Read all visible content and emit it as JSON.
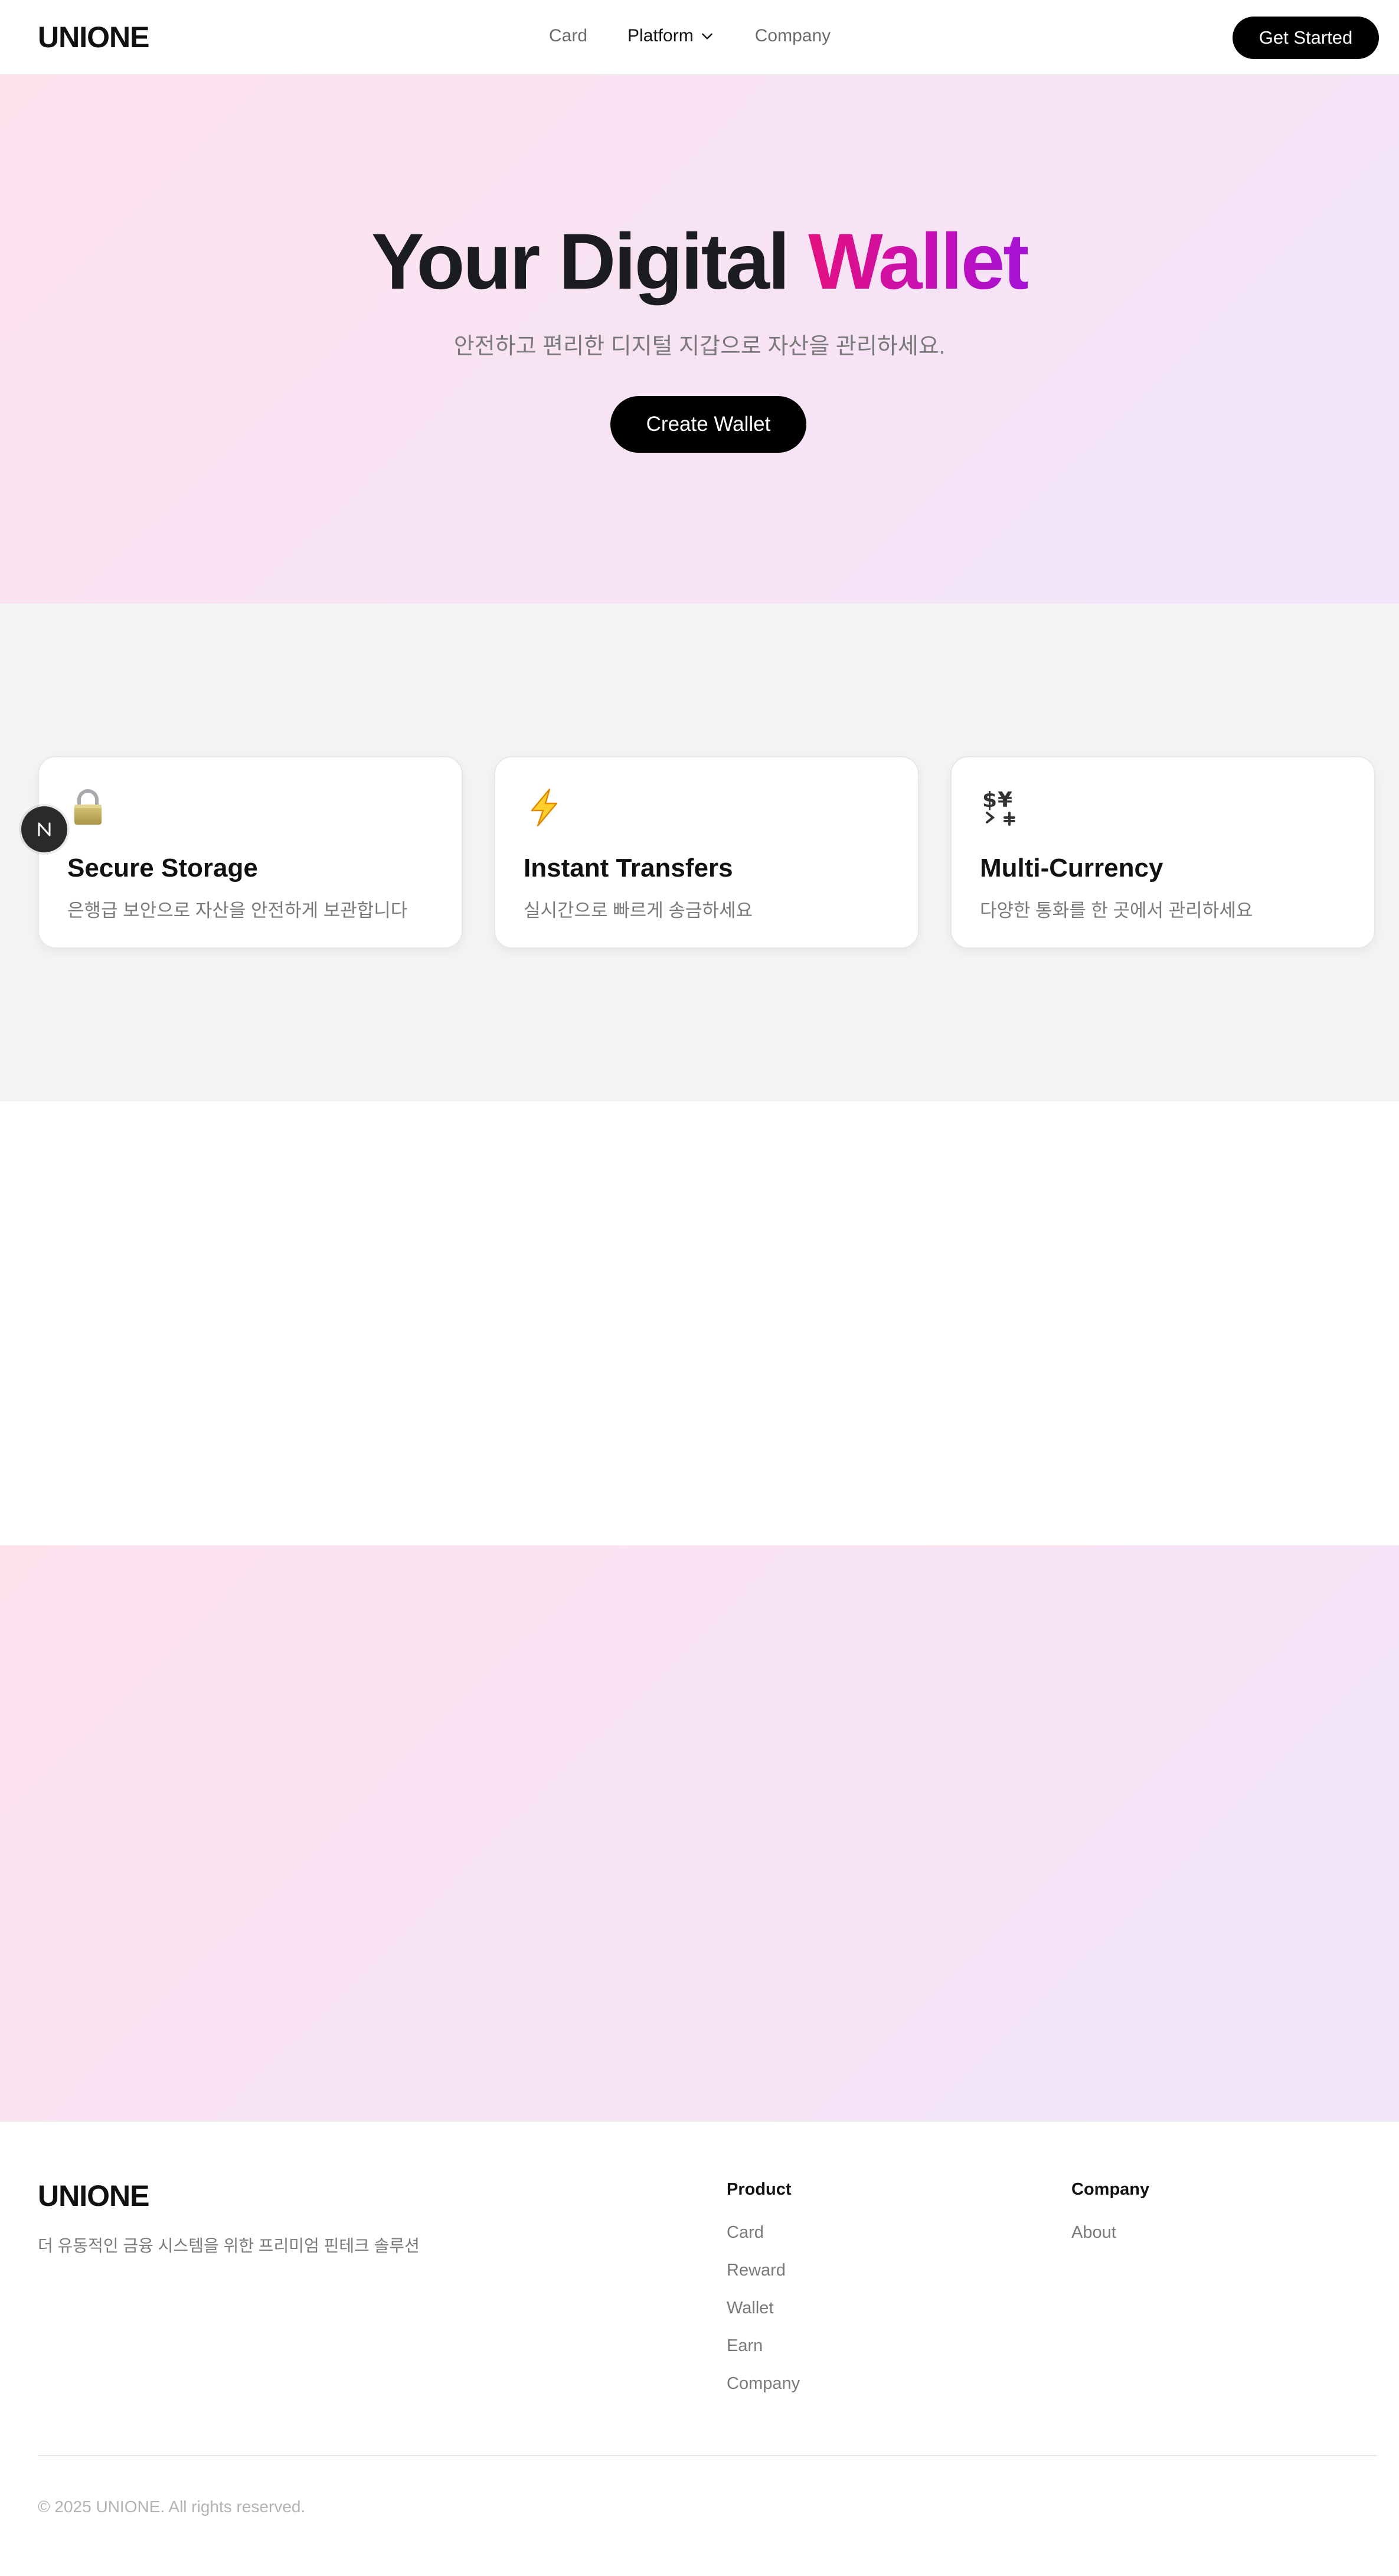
{
  "nav": {
    "logo": "UNIONE",
    "links": [
      "Card",
      "Platform",
      "Company"
    ],
    "cta_label": "Get Started"
  },
  "hero": {
    "title_part1": "Your Digital ",
    "title_highlight": "Wallet",
    "subtitle": "안전하고 편리한 디지털 지갑으로 자산을 관리하세요.",
    "button_label": "Create Wallet"
  },
  "features": [
    {
      "icon": "lock-icon",
      "title": "Secure Storage",
      "description": "은행급 보안으로 자산을 안전하게 보관합니다"
    },
    {
      "icon": "lightning-icon",
      "title": "Instant Transfers",
      "description": "실시간으로 빠르게 송금하세요"
    },
    {
      "icon": "currency-exchange-icon",
      "title": "Multi-Currency",
      "description": "다양한 통화를 한 곳에서 관리하세요"
    }
  ],
  "dev_badge": {
    "icon": "n-logo-icon"
  },
  "footer": {
    "logo": "UNIONE",
    "tagline": "더 유동적인 금융 시스템을 위한 프리미엄 핀테크 솔루션",
    "columns": [
      {
        "heading": "Product",
        "links": [
          "Card",
          "Reward",
          "Wallet",
          "Earn",
          "Company"
        ]
      },
      {
        "heading": "Company",
        "links": [
          "About"
        ]
      }
    ],
    "copyright": "© 2025 UNIONE. All rights reserved."
  },
  "colors": {
    "accent_gradient_start": "#e4117f",
    "accent_gradient_end": "#a512d6",
    "button_bg": "#000000",
    "hero_bg_start": "#fde2ee",
    "hero_bg_end": "#f2e4fb"
  }
}
